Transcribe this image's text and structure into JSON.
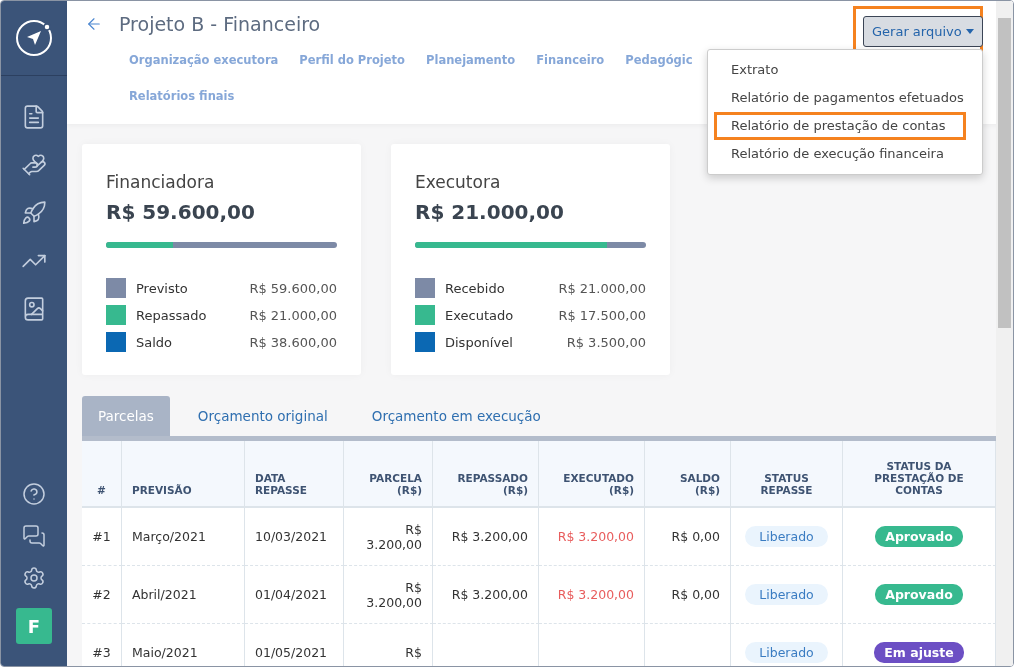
{
  "sidebar": {
    "avatar": "F"
  },
  "header": {
    "title": "Projeto B - Financeiro",
    "nav": [
      {
        "label": "Organização executora",
        "selected": false
      },
      {
        "label": "Perfil do Projeto",
        "selected": false
      },
      {
        "label": "Planejamento",
        "selected": false
      },
      {
        "label": "Financeiro",
        "selected": false
      },
      {
        "label": "Pedagógic",
        "selected": false
      },
      {
        "label": "Relatórios finais",
        "selected": false
      }
    ]
  },
  "export_button": {
    "label": "Gerar arquivo",
    "highlighted": true
  },
  "export_menu": [
    {
      "label": "Extrato",
      "highlighted": false
    },
    {
      "label": "Relatório de pagamentos efetuados",
      "highlighted": false
    },
    {
      "label": "Relatório de prestação de contas",
      "highlighted": true
    },
    {
      "label": "Relatório de execução financeira",
      "highlighted": false
    }
  ],
  "cards": [
    {
      "title": "Financiadora",
      "total": "R$ 59.600,00",
      "level": 0.29,
      "legend": [
        {
          "label": "Previsto",
          "value": "R$ 59.600,00",
          "color": "#7d8aa6"
        },
        {
          "label": "Repassado",
          "value": "R$ 21.000,00",
          "color": "#37b98f"
        },
        {
          "label": "Saldo",
          "value": "R$ 38.600,00",
          "color": "#0b68b3"
        }
      ]
    },
    {
      "title": "Executora",
      "total": "R$ 21.000,00",
      "level": 0.83,
      "legend": [
        {
          "label": "Recebido",
          "value": "R$ 21.000,00",
          "color": "#7d8aa6"
        },
        {
          "label": "Executado",
          "value": "R$ 17.500,00",
          "color": "#37b98f"
        },
        {
          "label": "Disponível",
          "value": "R$ 3.500,00",
          "color": "#0b68b3"
        }
      ]
    }
  ],
  "tabs": [
    {
      "label": "Parcelas",
      "selected": true
    },
    {
      "label": "Orçamento original",
      "selected": false
    },
    {
      "label": "Orçamento em execução",
      "selected": false
    }
  ],
  "table": {
    "columns": [
      "#",
      "PREVISÃO",
      "DATA REPASSE",
      "PARCELA (R$)",
      "REPASSADO (R$)",
      "EXECUTADO (R$)",
      "SALDO (R$)",
      "STATUS REPASSE",
      "STATUS DA PRESTAÇÃO DE CONTAS"
    ],
    "rows": [
      {
        "num": "#1",
        "forecast": "Março/2021",
        "date": "10/03/2021",
        "parcel": "R$ 3.200,00",
        "transferred": "R$ 3.200,00",
        "executed": "R$ 3.200,00",
        "balance": "R$ 0,00",
        "transfer_status": "Liberado",
        "report_status": {
          "label": "Aprovado",
          "color": "#37b98f"
        }
      },
      {
        "num": "#2",
        "forecast": "Abril/2021",
        "date": "01/04/2021",
        "parcel": "R$ 3.200,00",
        "transferred": "R$ 3.200,00",
        "executed": "R$ 3.200,00",
        "balance": "R$ 0,00",
        "transfer_status": "Liberado",
        "report_status": {
          "label": "Aprovado",
          "color": "#37b98f"
        }
      },
      {
        "num": "#3",
        "forecast": "Maio/2021",
        "date": "01/05/2021",
        "parcel": "R$",
        "transfer_status": "Liberado",
        "report_status": {
          "label": "Em ajuste",
          "color": "#6c4fc4"
        }
      }
    ]
  }
}
